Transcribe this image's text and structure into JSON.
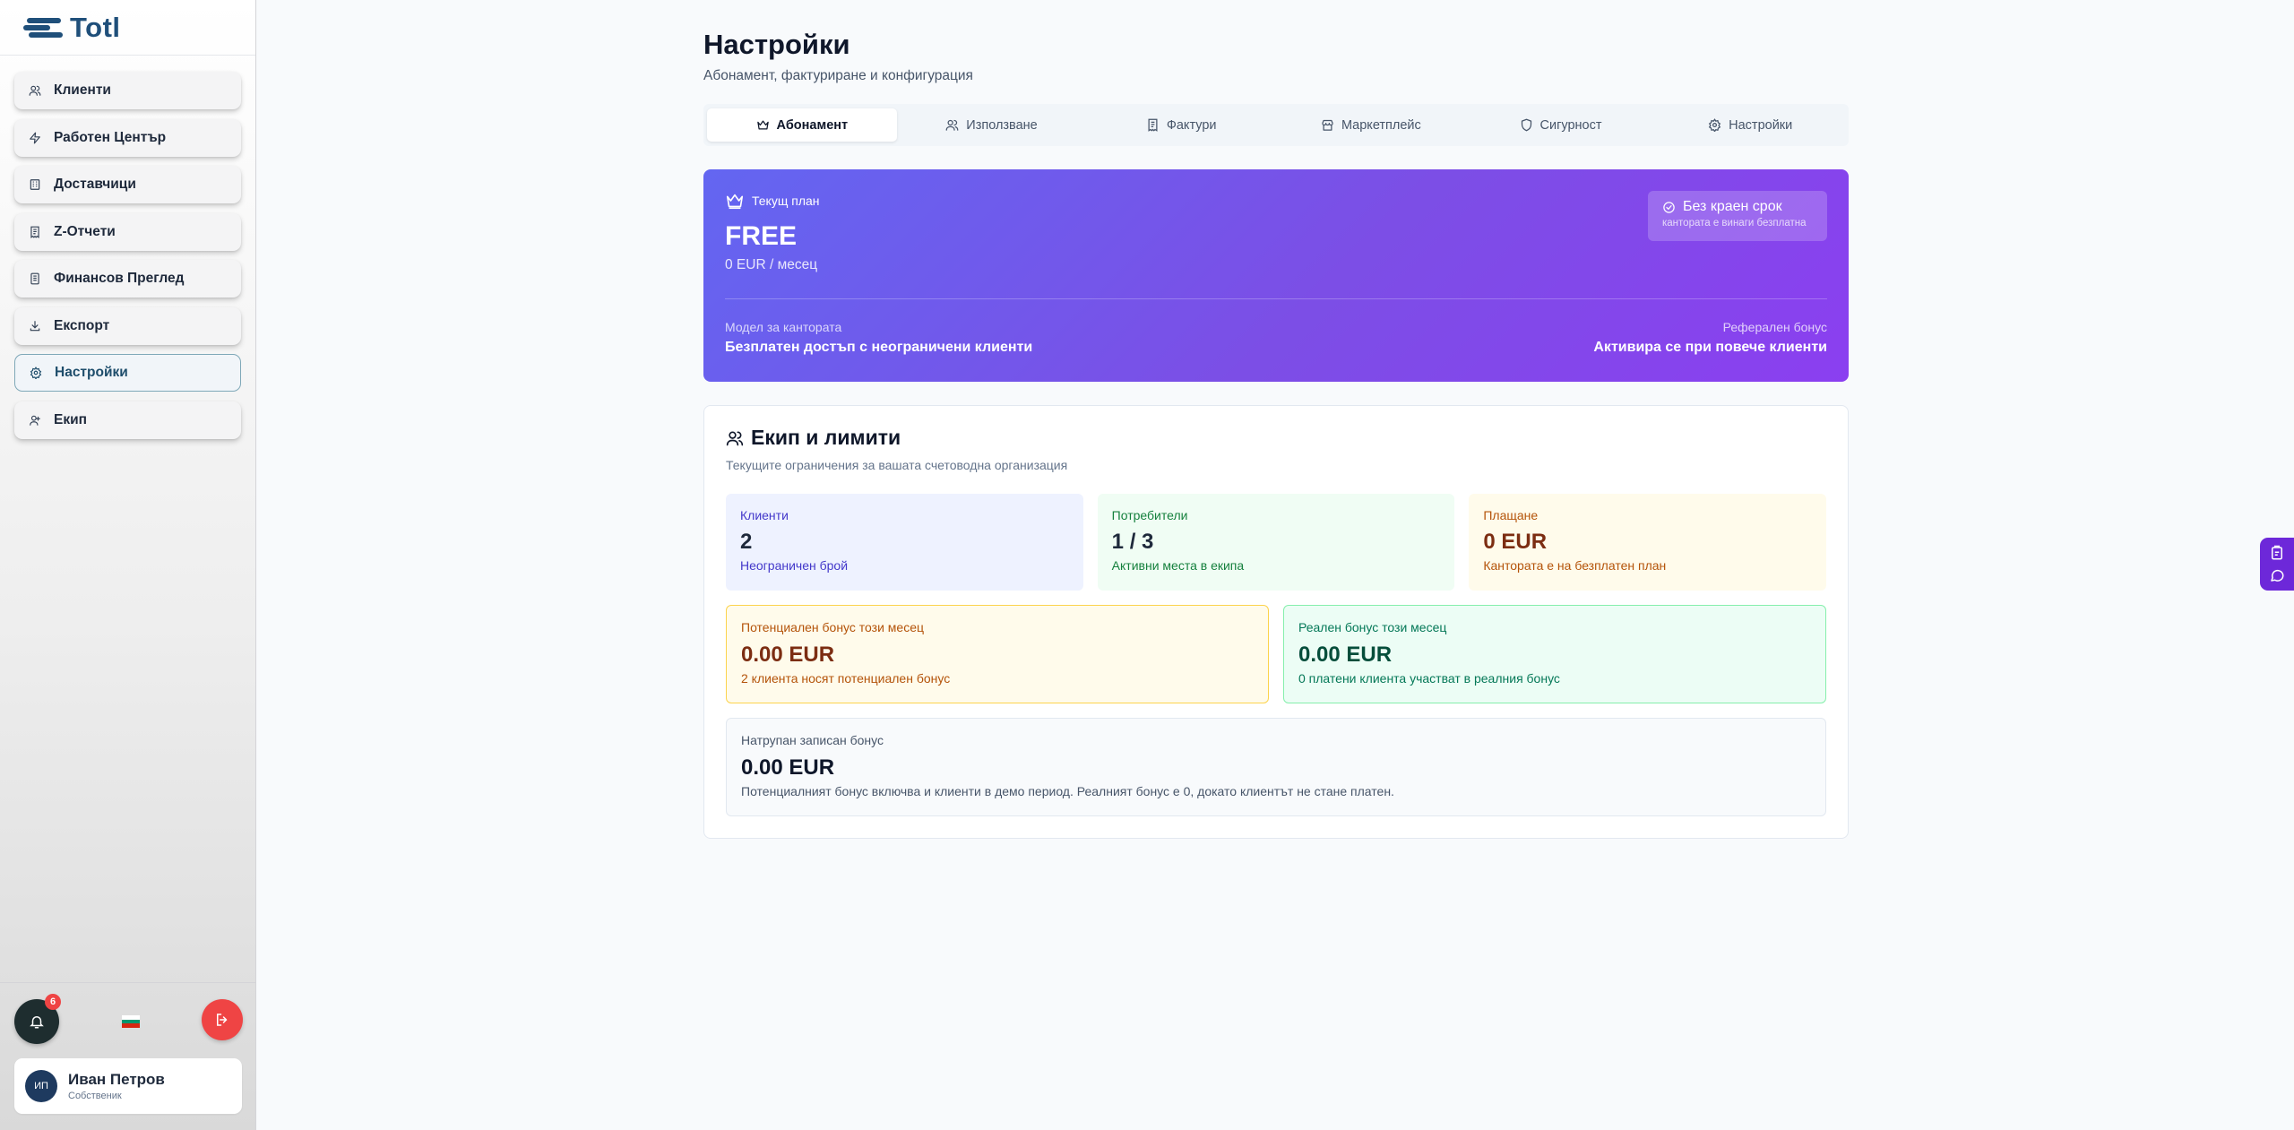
{
  "app": {
    "logo_text": "Totl"
  },
  "sidebar": {
    "items": [
      {
        "label": "Клиенти",
        "icon": "users-icon"
      },
      {
        "label": "Работен Център",
        "icon": "zap-icon"
      },
      {
        "label": "Доставчици",
        "icon": "building-icon"
      },
      {
        "label": "Z-Отчети",
        "icon": "receipt-icon"
      },
      {
        "label": "Финансов Преглед",
        "icon": "report-icon"
      },
      {
        "label": "Експорт",
        "icon": "download-icon"
      },
      {
        "label": "Настройки",
        "icon": "gear-icon",
        "active": true
      },
      {
        "label": "Екип",
        "icon": "team-icon"
      }
    ],
    "notifications_count": "6",
    "language_flag": "bg-flag",
    "user": {
      "initials": "ИП",
      "name": "Иван Петров",
      "role": "Собственик"
    }
  },
  "page": {
    "title": "Настройки",
    "subtitle": "Абонамент, фактуриране и конфигурация"
  },
  "tabs": [
    {
      "label": "Абонамент",
      "icon": "crown-icon",
      "active": true
    },
    {
      "label": "Използване",
      "icon": "users-icon"
    },
    {
      "label": "Фактури",
      "icon": "receipt-icon"
    },
    {
      "label": "Маркетплейс",
      "icon": "store-icon"
    },
    {
      "label": "Сигурност",
      "icon": "shield-icon"
    },
    {
      "label": "Настройки",
      "icon": "gear-icon"
    }
  ],
  "plan": {
    "label": "Текущ план",
    "name": "FREE",
    "price": "0 EUR / месец",
    "badge_title": "Без краен срок",
    "badge_sub": "кантората е винаги безплатна",
    "model_key": "Модел за кантората",
    "model_value": "Безплатен достъп с неограничени клиенти",
    "referral_key": "Реферален бонус",
    "referral_value": "Активира се при повече клиенти"
  },
  "team": {
    "title": "Екип и лимити",
    "subtitle": "Текущите ограничения за вашата счетоводна организация",
    "stats": [
      {
        "key": "Клиенти",
        "value": "2",
        "desc": "Неограничен брой"
      },
      {
        "key": "Потребители",
        "value": "1 / 3",
        "desc": "Активни места в екипа"
      },
      {
        "key": "Плащане",
        "value": "0 EUR",
        "desc": "Кантората е на безплатен план"
      }
    ],
    "potential_bonus": {
      "key": "Потенциален бонус този месец",
      "value": "0.00 EUR",
      "desc": "2 клиента носят потенциален бонус"
    },
    "real_bonus": {
      "key": "Реален бонус този месец",
      "value": "0.00 EUR",
      "desc": "0 платени клиента участват в реалния бонус"
    },
    "accumulated": {
      "key": "Натрупан записан бонус",
      "value": "0.00 EUR",
      "desc": "Потенциалният бонус включва и клиенти в демо период. Реалният бонус е 0, докато клиентът не стане платен."
    }
  },
  "colors": {
    "accent": "#7c4ee6",
    "brand": "#1f4f7a",
    "danger": "#ef4444"
  }
}
